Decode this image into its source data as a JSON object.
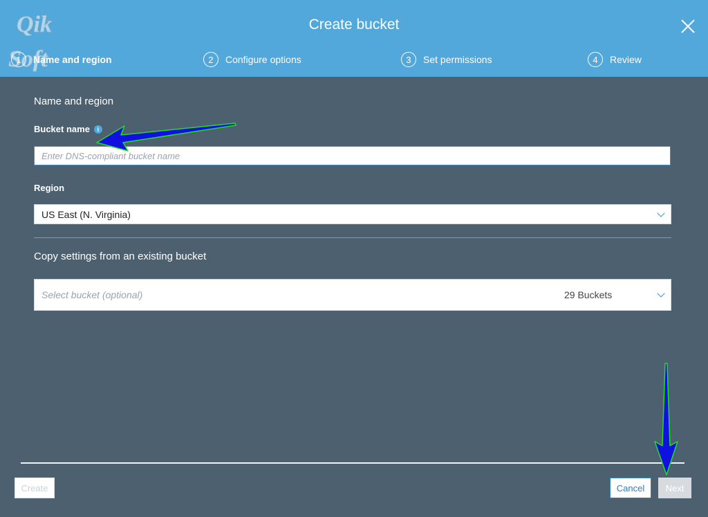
{
  "logo": {
    "text": "Qik Soft"
  },
  "header": {
    "title": "Create bucket"
  },
  "steps": [
    {
      "num": "1",
      "label": "Name and region"
    },
    {
      "num": "2",
      "label": "Configure options"
    },
    {
      "num": "3",
      "label": "Set permissions"
    },
    {
      "num": "4",
      "label": "Review"
    }
  ],
  "form": {
    "section_title": "Name and region",
    "bucket_name_label": "Bucket name",
    "bucket_name_placeholder": "Enter DNS-compliant bucket name",
    "bucket_name_value": "",
    "region_label": "Region",
    "region_value": "US East (N. Virginia)",
    "copy_title": "Copy settings from an existing bucket",
    "select_placeholder": "Select bucket (optional)",
    "bucket_count": "29 Buckets"
  },
  "footer": {
    "create_label": "Create",
    "cancel_label": "Cancel",
    "next_label": "Next"
  },
  "colors": {
    "header": "#52a7db",
    "body": "#4d6070",
    "accent": "#2a7fc1",
    "annotation_arrow": "#1010e0",
    "annotation_outline": "#22dd22"
  },
  "icons": [
    "close-icon",
    "info-icon",
    "chevron-down-icon",
    "annotation-arrow-icon"
  ]
}
